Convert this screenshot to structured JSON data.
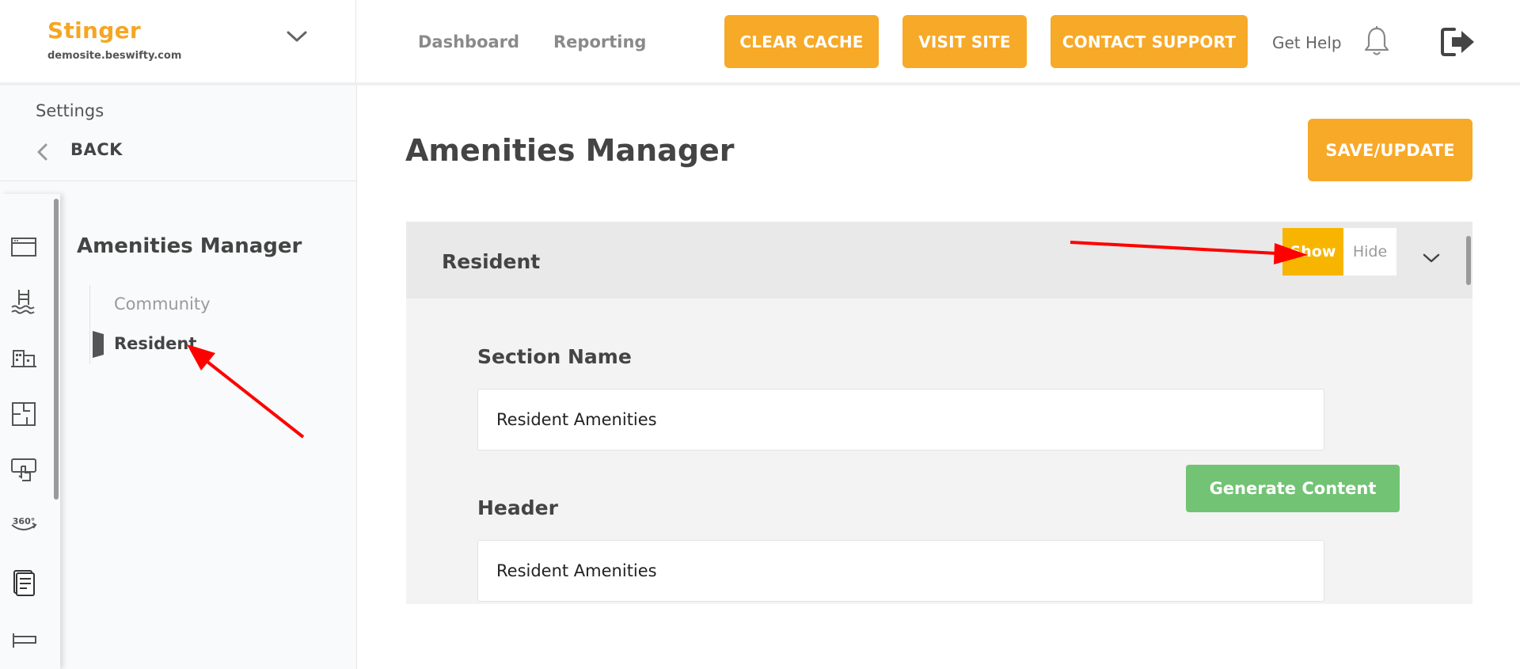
{
  "brand": {
    "name": "Stinger",
    "domain": "demosite.beswifty.com"
  },
  "nav": {
    "dashboard": "Dashboard",
    "reporting": "Reporting"
  },
  "toolbar": {
    "clear_cache": "CLEAR CACHE",
    "visit_site": "VISIT SITE",
    "contact_support": "CONTACT SUPPORT",
    "get_help": "Get Help"
  },
  "sidebar": {
    "settings": "Settings",
    "back": "BACK",
    "section_title": "Amenities Manager",
    "items": [
      {
        "label": "Community",
        "active": false
      },
      {
        "label": "Resident",
        "active": true
      }
    ],
    "rail_icons": [
      "browser-window-icon",
      "pool-icon",
      "buildings-icon",
      "floorplan-icon",
      "touch-screen-icon",
      "360-view-icon",
      "documents-icon",
      "sign-icon"
    ]
  },
  "main": {
    "title": "Amenities Manager",
    "save_label": "SAVE/UPDATE",
    "panel": {
      "title": "Resident",
      "show_label": "Show",
      "hide_label": "Hide",
      "visibility": "Show",
      "section_name_label": "Section Name",
      "section_name_value": "Resident Amenities",
      "generate_label": "Generate Content",
      "header_label": "Header",
      "header_value": "Resident Amenities"
    }
  },
  "colors": {
    "accent": "#f7a928",
    "toggle_active": "#f7b500",
    "generate": "#72c374",
    "annotation": "#ff0000"
  }
}
